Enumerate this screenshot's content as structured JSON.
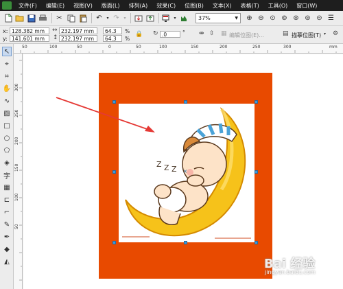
{
  "menu": {
    "items": [
      "文件(F)",
      "编辑(E)",
      "视图(V)",
      "版面(L)",
      "排列(A)",
      "效果(C)",
      "位图(B)",
      "文本(X)",
      "表格(T)",
      "工具(O)",
      "窗口(W)"
    ]
  },
  "toolbar": {
    "zoom": "37%"
  },
  "properties": {
    "x_label": "x:",
    "x_value": "128.382 mm",
    "y_label": "y:",
    "y_value": "141.601 mm",
    "width_value": "232.197 mm",
    "height_value": "232.197 mm",
    "scale_x": "64.3",
    "scale_y": "64.3",
    "percent1": "%",
    "percent2": "%",
    "rotation": ".0",
    "degree": "°",
    "edit_bitmap": "编辑位图(E)...",
    "trace_bitmap": "描摹位图(T)"
  },
  "ruler": {
    "top_ticks": [
      "50",
      "100",
      "50",
      "0",
      "50",
      "100",
      "150",
      "200",
      "250",
      "300"
    ],
    "left_ticks": [
      "300",
      "250",
      "200",
      "150",
      "100",
      "50"
    ],
    "unit": "mm"
  },
  "watermark": {
    "brand": "Bai 经验",
    "url": "jingyan.baidu.com"
  },
  "colors": {
    "page_fill": "#e84a00",
    "handle": "#3a9bdc",
    "arrow": "#e53935",
    "moon": "#f6c21a"
  }
}
